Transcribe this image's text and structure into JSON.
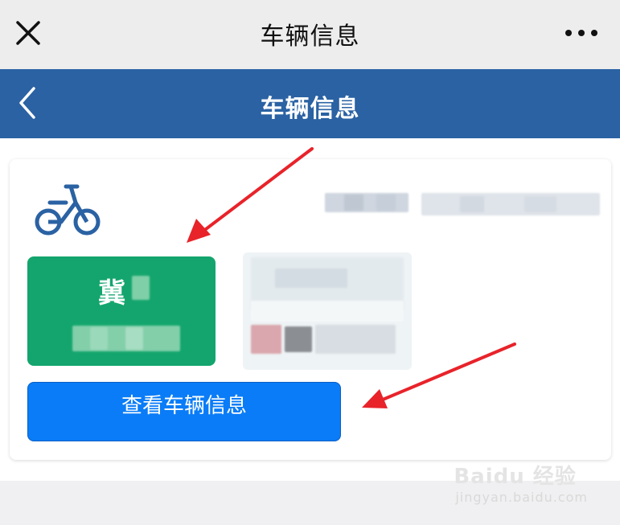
{
  "wechat_bar": {
    "title": "车辆信息"
  },
  "nav_bar": {
    "title": "车辆信息"
  },
  "vehicle_card": {
    "plate_province": "冀",
    "view_button_label": "查看车辆信息"
  },
  "watermark": {
    "main": "Baidu 经验",
    "sub": "jingyan.baidu.com"
  },
  "colors": {
    "nav_blue": "#2a62a3",
    "plate_green": "#13a56d",
    "button_blue": "#0a7cf7",
    "arrow_red": "#e8232a"
  }
}
